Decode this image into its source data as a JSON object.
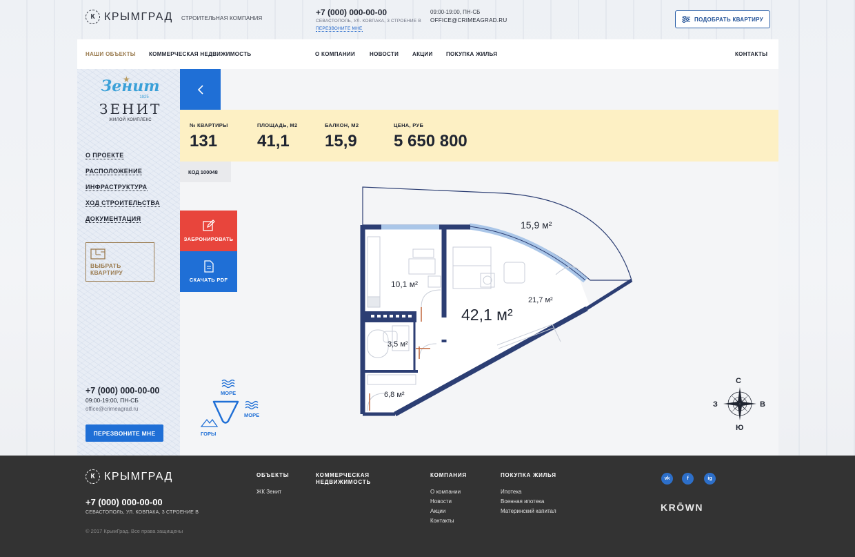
{
  "header": {
    "logo_text": "КРЫМГРАД",
    "logo_letter": "К",
    "tagline": "СТРОИТЕЛЬНАЯ КОМПАНИЯ",
    "phone": "+7 (000) 000-00-00",
    "address": "СЕВАСТОПОЛЬ, УЛ. КОВПАКА, 3 СТРОЕНИЕ В",
    "callback": "ПЕРЕЗВОНИТЕ МНЕ",
    "hours": "09:00-19:00, ПН-СБ",
    "email": "OFFICE@CRIMEAGRAD.RU",
    "pick_button": "ПОДОБРАТЬ КВАРТИРУ"
  },
  "nav": {
    "items": [
      {
        "label": "НАШИ ОБЪЕКТЫ"
      },
      {
        "label": "КОММЕРЧЕСКАЯ НЕДВИЖИМОСТЬ"
      },
      {
        "label": "О КОМПАНИИ"
      },
      {
        "label": "НОВОСТИ"
      },
      {
        "label": "АКЦИИ"
      },
      {
        "label": "ПОКУПКА ЖИЛЬЯ"
      },
      {
        "label": "КОНТАКТЫ"
      }
    ]
  },
  "sidebar": {
    "brand_script": "Зенит",
    "brand_year": "1925",
    "brand_name": "ЗЕНИТ",
    "brand_sub": "ЖИЛОЙ КОМПЛЕКС",
    "menu": [
      {
        "label": "О ПРОЕКТЕ"
      },
      {
        "label": "РАСПОЛОЖЕНИЕ"
      },
      {
        "label": "ИНФРАСТРУКТУРА"
      },
      {
        "label": "ХОД СТРОИТЕЛЬСТВА"
      },
      {
        "label": "ДОКУМЕНТАЦИЯ"
      }
    ],
    "choose_line1": "ВЫБРАТЬ",
    "choose_line2": "КВАРТИРУ",
    "phone": "+7 (000) 000-00-00",
    "hours": "09:00-19:00, ПН-СБ",
    "email": "office@crimeagrad.ru",
    "callback_button": "ПЕРЕЗВОНИТЕ МНЕ"
  },
  "apartment": {
    "number_label": "№ КВАРТИРЫ",
    "number": "131",
    "area_label": "ПЛОЩАДЬ, М2",
    "area": "41,1",
    "balcony_label": "БАЛКОН, М2",
    "balcony": "15,9",
    "price_label": "ЦЕНА, РУБ",
    "price": "5 650 800",
    "code": "КОД 100048"
  },
  "actions": {
    "reserve": "ЗАБРОНИРОВАТЬ",
    "pdf": "СКАЧАТЬ PDF"
  },
  "plan": {
    "rooms": [
      {
        "area": "15,9 м²"
      },
      {
        "area": "10,1 м²"
      },
      {
        "area": "21,7 м²"
      },
      {
        "area": "42,1 м²"
      },
      {
        "area": "3,5 м²"
      },
      {
        "area": "6,8 м²"
      }
    ],
    "views": {
      "sea_top": "МОРЕ",
      "sea_right": "МОРЕ",
      "mountains": "ГОРЫ"
    },
    "compass": {
      "n": "С",
      "s": "Ю",
      "w": "З",
      "e": "В"
    }
  },
  "footer": {
    "logo_text": "КРЫМГРАД",
    "phone": "+7 (000) 000-00-00",
    "address": "СЕВАСТОПОЛЬ, УЛ. КОВПАКА, 3 СТРОЕНИЕ В",
    "copyright": "© 2017 КрымГрад. Все права защищены",
    "col_objects_title": "ОБЪЕКТЫ",
    "col_objects_links": [
      "ЖК Зенит"
    ],
    "col_commercial_title_1": "КОММЕРЧЕСКАЯ",
    "col_commercial_title_2": "НЕДВИЖИМОСТЬ",
    "col_company_title": "КОМПАНИЯ",
    "col_company_links": [
      "О компании",
      "Новости",
      "Акции",
      "Контакты"
    ],
    "col_buy_title": "ПОКУПКА ЖИЛЬЯ",
    "col_buy_links": [
      "Ипотека",
      "Военная ипотека",
      "Материнский капитал"
    ],
    "social": [
      "vk",
      "f",
      "ig"
    ],
    "krown": "KRŌWN"
  },
  "colors": {
    "accent_blue": "#1f6fd6",
    "accent_red": "#e8453c",
    "info_bar": "#fdf0c4",
    "gold": "#9a7b4f",
    "wall": "#2c3e73"
  }
}
